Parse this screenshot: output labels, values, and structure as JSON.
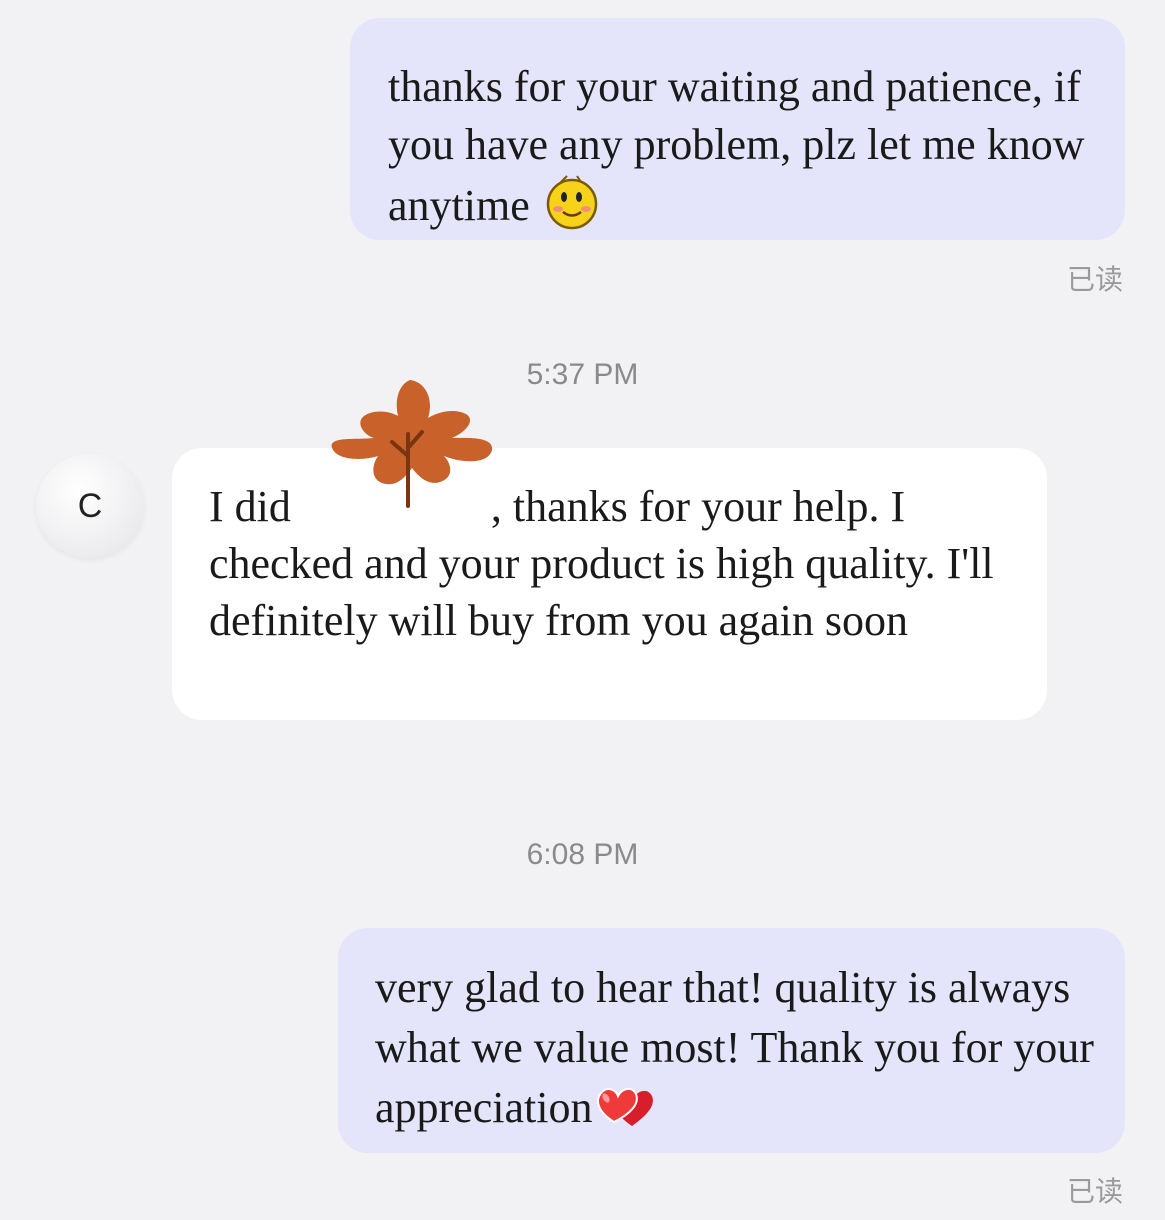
{
  "messages": [
    {
      "direction": "outgoing",
      "text": "thanks for your waiting and patience, if you have any problem, plz let me know anytime",
      "emoji": "smiley-face",
      "status": "已读"
    },
    {
      "direction": "incoming",
      "timestamp": "5:37 PM",
      "sender_initial": "C",
      "text_before": "I did",
      "text_after": ", thanks for your help. I checked and your product is high quality. I'll definitely will buy from you again soon",
      "redaction": "maple-leaf-sticker"
    },
    {
      "direction": "outgoing",
      "timestamp": "6:08 PM",
      "text": "very glad to hear that! quality is always what we value most! Thank you for your appreciation",
      "emoji": "hearts",
      "status": "已读"
    }
  ],
  "colors": {
    "background": "#f2f2f5",
    "outgoing_bubble": "#e4e4fa",
    "incoming_bubble": "#ffffff",
    "leaf": "#c8622a"
  }
}
